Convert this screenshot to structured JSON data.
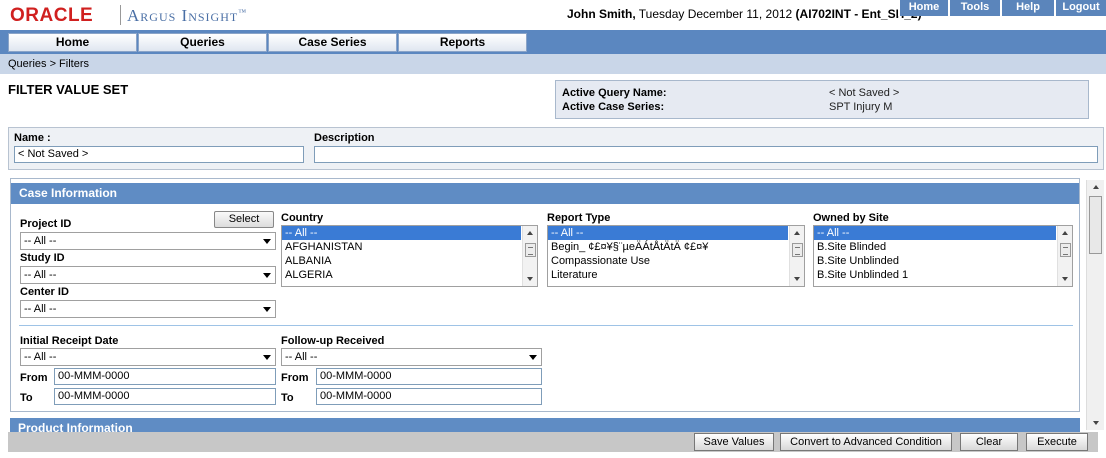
{
  "header": {
    "logo": "ORACLE",
    "product": "Argus Insight",
    "trademark": "™",
    "user_name": "John Smith,",
    "date_text": " Tuesday December 11, 2012 ",
    "env": "(AI702INT - Ent_SH_2)",
    "top_links": [
      "Home",
      "Tools",
      "Help",
      "Logout"
    ]
  },
  "nav": {
    "tabs": [
      "Home",
      "Queries",
      "Case Series",
      "Reports"
    ]
  },
  "breadcrumb": "Queries  >  Filters",
  "page_title": "FILTER VALUE SET",
  "active_query": {
    "name_label": "Active Query Name:",
    "name_value": "< Not Saved >",
    "series_label": "Active Case Series:",
    "series_value": "SPT Injury M"
  },
  "name_section": {
    "name_label": "Name :",
    "name_value": "< Not Saved >",
    "description_label": "Description",
    "description_value": ""
  },
  "case_info": {
    "header": "Case Information",
    "project_id_label": "Project ID",
    "select_button": "Select",
    "project_id_value": "-- All --",
    "study_id_label": "Study ID",
    "study_id_value": "-- All --",
    "center_id_label": "Center ID",
    "center_id_value": "-- All --",
    "country_label": "Country",
    "country_options": [
      "-- All --",
      "AFGHANISTAN",
      "ALBANIA",
      "ALGERIA"
    ],
    "report_type_label": "Report Type",
    "report_type_options": [
      "-- All --",
      "Begin_ ¢£¤¥§¨µeÄÁtÅtÄtÄ ¢£¤¥",
      "Compassionate Use",
      "Literature"
    ],
    "owned_by_site_label": "Owned by Site",
    "owned_by_site_options": [
      "-- All --",
      "B.Site Blinded",
      "B.Site Unblinded",
      "B.Site Unblinded 1"
    ],
    "initial_receipt_label": "Initial Receipt Date",
    "initial_receipt_value": "-- All --",
    "followup_label": "Follow-up Received",
    "followup_value": "-- All --",
    "from_label": "From",
    "to_label": "To",
    "date_placeholder": "00-MMM-0000"
  },
  "product_info": {
    "header": "Product Information"
  },
  "actions": {
    "save_values": "Save Values",
    "convert": "Convert to Advanced Condition",
    "clear": "Clear",
    "execute": "Execute"
  },
  "colors": {
    "oracle_red": "#d0201f",
    "nav_blue": "#5b87c0",
    "section_blue": "#5f8cc4",
    "selection_blue": "#3a7bd5"
  }
}
